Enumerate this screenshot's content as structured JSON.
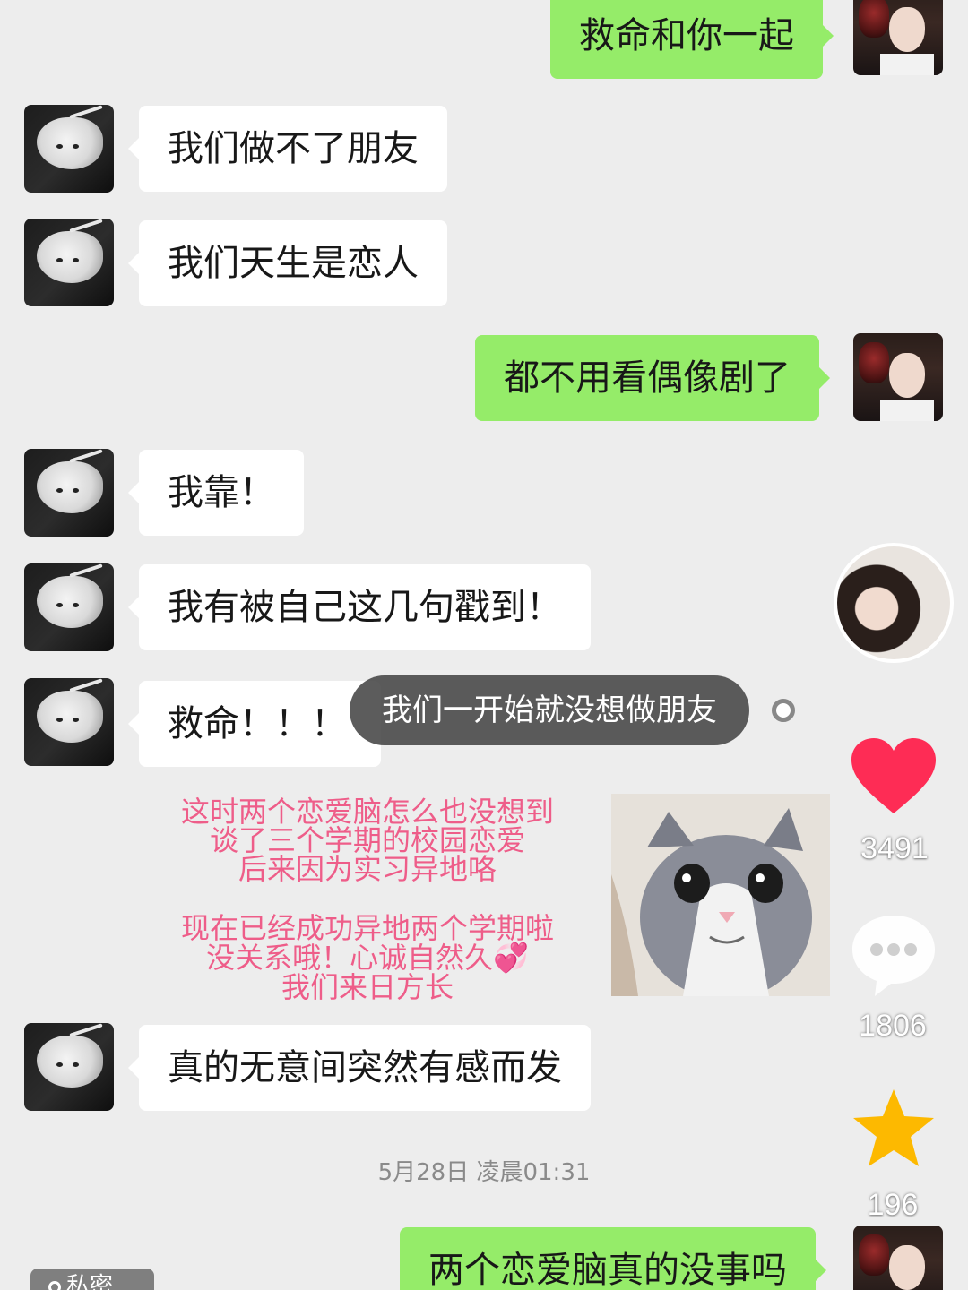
{
  "messages": [
    {
      "side": "right",
      "text": "救命和你一起"
    },
    {
      "side": "left",
      "text": "我们做不了朋友"
    },
    {
      "side": "left",
      "text": "我们天生是恋人"
    },
    {
      "side": "right",
      "text": "都不用看偶像剧了"
    },
    {
      "side": "left",
      "text": "我靠！"
    },
    {
      "side": "left",
      "text": "我有被自己这几句戳到！"
    },
    {
      "side": "left",
      "text": "救命！！！"
    },
    {
      "side": "left",
      "text": "真的无意间突然有感而发"
    },
    {
      "side": "right",
      "text": "两个恋爱脑真的没事吗"
    }
  ],
  "danmaku": {
    "text": "我们一开始就没想做朋友"
  },
  "caption": {
    "lines": [
      "这时两个恋爱脑怎么也没想到",
      "谈了三个学期的校园恋爱",
      "后来因为实习异地咯",
      "现在已经成功异地两个学期啦",
      "没关系哦！心诚自然久💞",
      "我们来日方长"
    ]
  },
  "timestamp": "5月28日 凌晨01:31",
  "sidebar": {
    "likes": "3491",
    "comments": "1806",
    "favorites": "196"
  },
  "dm_tag": "私密",
  "colors": {
    "chat_background": "#ededed",
    "sent_bubble": "#95ec69",
    "received_bubble": "#ffffff",
    "caption_text": "#ee5d89",
    "heart": "#fe2c55",
    "star": "#fdb900"
  },
  "icons": [
    "heart-icon",
    "comment-icon",
    "star-icon",
    "lock-icon"
  ]
}
